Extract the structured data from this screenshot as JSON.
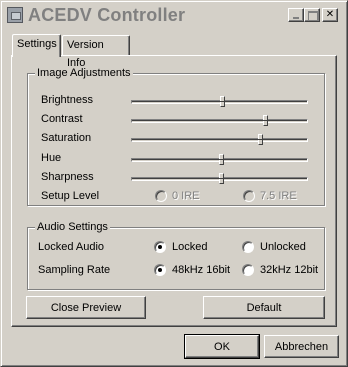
{
  "window": {
    "title": "ACEDV Controller",
    "minimize_icon": "minimize-icon",
    "maximize_icon": "maximize-icon",
    "close_icon": "close-icon",
    "close_glyph": "✕"
  },
  "tabs": [
    {
      "label": "Settings",
      "active": true
    },
    {
      "label": "Version Info",
      "active": false
    }
  ],
  "image_adjustments": {
    "title": "Image Adjustments",
    "sliders": [
      {
        "label": "Brightness",
        "position": 0.52
      },
      {
        "label": "Contrast",
        "position": 0.77
      },
      {
        "label": "Saturation",
        "position": 0.74
      },
      {
        "label": "Hue",
        "position": 0.51
      },
      {
        "label": "Sharpness",
        "position": 0.51
      }
    ],
    "setup_level": {
      "label": "Setup Level",
      "options": [
        "0 IRE",
        "7.5 IRE"
      ],
      "enabled": false
    }
  },
  "audio_settings": {
    "title": "Audio Settings",
    "locked_audio": {
      "label": "Locked Audio",
      "options": [
        "Locked",
        "Unlocked"
      ],
      "selected": "Locked"
    },
    "sampling_rate": {
      "label": "Sampling Rate",
      "options": [
        "48kHz 16bit",
        "32kHz 12bit"
      ],
      "selected": "48kHz 16bit"
    }
  },
  "buttons": {
    "close_preview": "Close Preview",
    "default": "Default",
    "ok": "OK",
    "cancel": "Abbrechen"
  },
  "colors": {
    "face": "#d4d0c8",
    "shadow": "#808080",
    "highlight": "#ffffff",
    "dark_shadow": "#404040"
  }
}
